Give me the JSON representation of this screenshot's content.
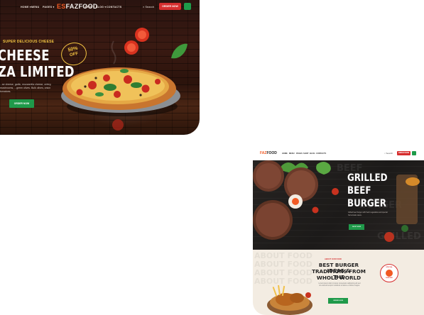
{
  "card1": {
    "nav": {
      "logo_prefix": "ES",
      "logo_suffix": "FAZFOOD",
      "items": [
        "HOME ▾",
        "MENU",
        "PAGES ▾",
        "SHOP ▾",
        "BLOG ▾",
        "CONTACTS"
      ],
      "search_label": "Search",
      "order_label": "ORDER NOW"
    },
    "hero": {
      "eyebrow": "SUPER DELICIOUS CHEESE",
      "title_line1": "CHEESE",
      "title_line2": "ZA LIMITED",
      "description": "...se cheese, garlic, mozzarella cheese, celery, mushrooms, ...green olives. Bulk olives, onion tomatoes.",
      "button_label": "ORDER NOW",
      "badge_percent": "50%",
      "badge_label": "OFF"
    }
  },
  "card2": {
    "nav": {
      "logo_prefix": "FAZ",
      "logo_suffix": "FOOD",
      "items": [
        "HOME",
        "MENU",
        "PAGES",
        "SHOP",
        "BLOG",
        "CONTACTS"
      ],
      "search_label": "Search",
      "order_label": "ORDER NOW"
    },
    "hero": {
      "ghost_words": [
        "BEEF",
        "BURGER",
        "GRILLED"
      ],
      "title_line1": "GRILLED",
      "title_line2": "BEEF",
      "title_line3": "BURGER",
      "description": "Grilled beef burger with fresh vegetables and special homemade sauce.",
      "button_label": "SHOP NOW"
    },
    "section": {
      "ghost_words": [
        "ABOUT FOOD",
        "ABOUT FOOD",
        "ABOUT FOOD",
        "ABOUT FOOD"
      ],
      "tag": "ABOUT OUR FOOD",
      "title_line1": "BEST BURGER IDEAS &",
      "title_line2": "TRADITIONS FROM THE",
      "title_line3": "WHOLE WORLD",
      "description": "Lorem ipsum dolor sit amet consectetur adipiscing elit sed do eiusmod tempor incididunt ut labore et dolore magna.",
      "button_label": "ORDER NOW",
      "stamp_top": "SPECIAL",
      "stamp_bottom": "BURGER"
    }
  },
  "colors": {
    "brand_orange": "#f15a24",
    "order_red": "#d62f2f",
    "cta_green": "#1f9a4a",
    "badge_yellow": "#f4c542"
  }
}
